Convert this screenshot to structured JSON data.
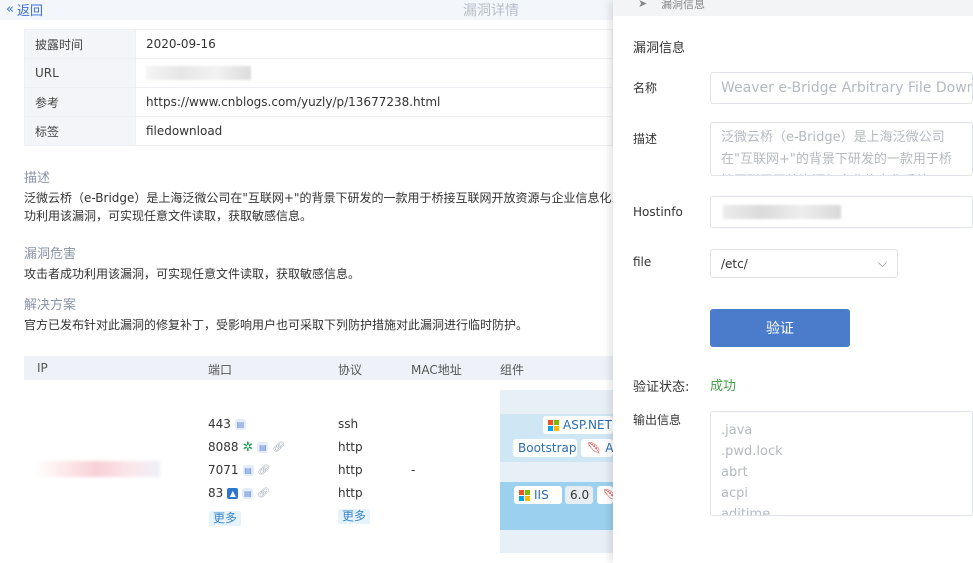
{
  "header": {
    "back_label": "返回",
    "title": "漏洞详情"
  },
  "info_rows": [
    {
      "key": "披露时间",
      "value": "2020-09-16"
    },
    {
      "key": "URL",
      "value": ""
    },
    {
      "key": "参考",
      "value": "https://www.cnblogs.com/yuzly/p/13677238.html"
    },
    {
      "key": "标签",
      "value": "filedownload"
    }
  ],
  "description": {
    "heading": "描述",
    "line1": "泛微云桥（e-Bridge）是上海泛微公司在\"互联网+\"的背景下研发的一款用于桥接互联网开放资源与企业信息化系",
    "line2": "功利用该漏洞，可实现任意文件读取，获取敏感信息。"
  },
  "harm": {
    "heading": "漏洞危害",
    "text": "攻击者成功利用该漏洞，可实现任意文件读取，获取敏感信息。"
  },
  "solution": {
    "heading": "解决方案",
    "text": "官方已发布针对此漏洞的修复补丁，受影响用户也可采取下列防护措施对此漏洞进行临时防护。"
  },
  "asset_table": {
    "headers": [
      "IP",
      "端口",
      "协议",
      "MAC地址",
      "组件"
    ],
    "ports": [
      {
        "port": "443",
        "proto": "ssh"
      },
      {
        "port": "8088",
        "proto": "http"
      },
      {
        "port": "7071",
        "proto": "http"
      },
      {
        "port": "83",
        "proto": "http"
      }
    ],
    "mac": "-",
    "more_label": "更多",
    "components": {
      "aspnet": "ASP.NET",
      "bootstrap": "Bootstrap",
      "a_trunc": "A",
      "iis": "IIS",
      "iis_version": "6.0"
    }
  },
  "panel": {
    "bar_title": "漏洞信息",
    "section_title": "漏洞信息",
    "name_label": "名称",
    "name_placeholder": "Weaver e-Bridge Arbitrary File Download",
    "desc_label": "描述",
    "desc_placeholder": "泛微云桥（e-Bridge）是上海泛微公司在\"互联网+\"的背景下研发的一款用于桥接互联网开放资源与企业信息化系统",
    "hostinfo_label": "Hostinfo",
    "file_label": "file",
    "file_value": "/etc/",
    "verify_button": "验证",
    "status_label": "验证状态:",
    "status_value": "成功",
    "output_label": "输出信息",
    "output_lines": [
      ".java",
      ".pwd.lock",
      "abrt",
      "acpi",
      "adjtime"
    ]
  },
  "colors": {
    "accent": "#4a7ccb",
    "success": "#43a047",
    "link": "#3b6fd0"
  }
}
